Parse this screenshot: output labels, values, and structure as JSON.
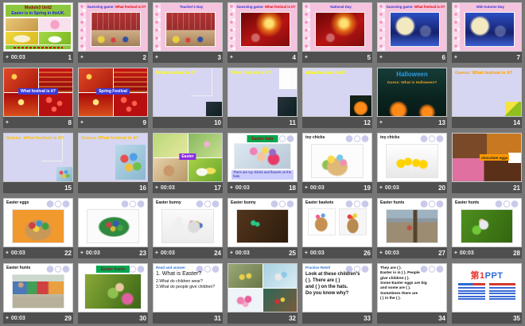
{
  "app": {
    "view": "slide-sorter-grid",
    "background": "#767676",
    "bar_bg": "#4f4f4f",
    "number_color": "#f5f5f5",
    "time_color": "#ededed",
    "star_color": "#d6d6d6",
    "transition_icon": "✦"
  },
  "slides": [
    {
      "n": "1",
      "time": "00:03",
      "star": true,
      "kind": "cover",
      "header_bg": "#8dc63f",
      "header": [
        {
          "t": "Module3 Unit2",
          "c": "#8b0000"
        },
        {
          "t": "Easter is in Spring in theUK.",
          "c": "#1a1aff"
        }
      ],
      "imgs": [
        "ph-c1",
        "ph-c2",
        "ph-c3",
        "ph-c4"
      ]
    },
    {
      "n": "2",
      "star": true,
      "kind": "pink",
      "photo": "ph-school",
      "title": [
        {
          "t": "Guessing game:",
          "c": "#3333cc"
        },
        {
          "t": "What festival is it?",
          "c": "#e60000"
        }
      ]
    },
    {
      "n": "3",
      "star": true,
      "kind": "pink",
      "photo": "ph-school",
      "title": [
        {
          "t": "Teacher's Day",
          "c": "#3333cc"
        }
      ]
    },
    {
      "n": "4",
      "star": true,
      "kind": "pink",
      "photo": "ph-national",
      "title": [
        {
          "t": "Guessing game:",
          "c": "#3333cc"
        },
        {
          "t": "What festival is it?",
          "c": "#e60000"
        }
      ]
    },
    {
      "n": "5",
      "star": true,
      "kind": "pink",
      "photo": "ph-national",
      "title": [
        {
          "t": "National Day",
          "c": "#3333cc"
        }
      ]
    },
    {
      "n": "6",
      "star": true,
      "kind": "pink",
      "photo": "ph-moon",
      "title": [
        {
          "t": "Guessing game:",
          "c": "#3333cc"
        },
        {
          "t": "What festival is it?",
          "c": "#e60000"
        }
      ]
    },
    {
      "n": "7",
      "star": true,
      "kind": "pink",
      "photo": "ph-moon",
      "title": [
        {
          "t": "Mid-Autumn Day",
          "c": "#3333cc"
        }
      ]
    },
    {
      "n": "8",
      "star": true,
      "kind": "gridlabel",
      "imgs": [
        "ph-r1",
        "ph-r2",
        "ph-r3",
        "ph-r4"
      ],
      "label": {
        "t": "What festival is it?",
        "bg": "#3b3bd8",
        "c": "#ffffff"
      }
    },
    {
      "n": "9",
      "star": true,
      "kind": "gridlabel",
      "imgs": [
        "ph-r1",
        "ph-r2",
        "ph-r3",
        "ph-r4"
      ],
      "label": {
        "t": "Spring Festival",
        "bg": "#3b3bd8",
        "c": "#ffffff"
      }
    },
    {
      "n": "10",
      "star": false,
      "kind": "quest",
      "text": "What festival is it?",
      "c": "#ffff00",
      "img": "ph-corner-dark",
      "img_size": "xs",
      "box": "outline"
    },
    {
      "n": "11",
      "star": false,
      "kind": "quest",
      "text": "What festival is it?",
      "c": "#ffff00",
      "img": "ph-corner-dark",
      "img_size": "sm",
      "box": "white"
    },
    {
      "n": "12",
      "star": false,
      "kind": "quest",
      "text": "What festival is it?",
      "c": "#ffff00",
      "img": "ph-pumpkin",
      "img_size": "md"
    },
    {
      "n": "13",
      "star": true,
      "kind": "hallow",
      "title": "Halloween",
      "title_c": "#2e9be6",
      "sub": "Guess: What is Halloween?",
      "sub_c": "#e8a020"
    },
    {
      "n": "14",
      "star": false,
      "kind": "quest",
      "text": "Guess: What festival is it?",
      "c": "#ffa000",
      "img": "ph-fold",
      "img_size": "xs"
    },
    {
      "n": "15",
      "star": false,
      "kind": "quest",
      "text": "Guess: What festival is it?",
      "c": "#ffc000",
      "img": "ph-eggs-mini",
      "img_size": "xs",
      "box": "outline"
    },
    {
      "n": "16",
      "star": false,
      "kind": "quest",
      "text": "Guess: What festival is it?",
      "c": "#ffc000",
      "img": "ph-eggs-mini",
      "img_size": "tall"
    },
    {
      "n": "17",
      "time": "00:03",
      "star": true,
      "kind": "gridlabel",
      "imgs": [
        "ph-q1",
        "ph-q2",
        "ph-q3",
        "ph-q4"
      ],
      "label": {
        "t": "Easter",
        "bg": "#8a2be2",
        "c": "#ffffff"
      }
    },
    {
      "n": "18",
      "time": "00:03",
      "star": true,
      "kind": "banner",
      "photo": "ph-child-hat",
      "banner": {
        "t": "Easter hats",
        "bg": "#00a650",
        "c": "#c00000"
      },
      "caption": {
        "t": "There are toy chicks and flowers on the hats.",
        "bg": "#ccccff",
        "c": "#1a1a8c"
      }
    },
    {
      "n": "19",
      "time": "00:03",
      "star": true,
      "kind": "white",
      "label": "toy chicks",
      "img": "ph-basket-chicks"
    },
    {
      "n": "20",
      "time": "00:03",
      "star": true,
      "kind": "white",
      "label": "toy chicks",
      "img": "ph-toy-chicks"
    },
    {
      "n": "21",
      "star": false,
      "kind": "collage",
      "label": {
        "t": "chocolate eggs",
        "bg": "#ff9900",
        "c": "#222222"
      }
    },
    {
      "n": "22",
      "time": "00:03",
      "star": true,
      "kind": "white",
      "label": "Easter eggs",
      "img": "ph-eggs-orange"
    },
    {
      "n": "23",
      "time": "00:03",
      "star": true,
      "kind": "white",
      "label": null,
      "img": "ph-eggs-plate"
    },
    {
      "n": "24",
      "time": "00:03",
      "star": true,
      "kind": "white",
      "label": "Easter bunny",
      "img": "ph-rabbit"
    },
    {
      "n": "25",
      "time": "00:03",
      "star": true,
      "kind": "white",
      "label": "Easter bunny",
      "img": "ph-neon"
    },
    {
      "n": "26",
      "time": "00:03",
      "star": true,
      "kind": "two",
      "label": "Easter baskets",
      "imgs": [
        "ph-basket-cartoon",
        "ph-basket-tulips"
      ]
    },
    {
      "n": "27",
      "time": "00:03",
      "star": true,
      "kind": "white",
      "label": "Easter hunts",
      "img": "ph-hunt-outdoor"
    },
    {
      "n": "28",
      "time": "00:03",
      "star": true,
      "kind": "white",
      "label": "Easter hunts",
      "img": "ph-hunt-grass"
    },
    {
      "n": "29",
      "time": "00:03",
      "star": true,
      "kind": "white",
      "label": "Easter hunts",
      "img": "ph-hunt-kids"
    },
    {
      "n": "30",
      "star": false,
      "kind": "banner",
      "photo": "ph-hunt-girl",
      "banner": {
        "t": "Easter hunts",
        "bg": "#00a650",
        "c": "#7b2020"
      }
    },
    {
      "n": "31",
      "star": false,
      "kind": "qa",
      "label": {
        "t": "Read and answer",
        "c": "#2e75d4"
      },
      "big_first": true,
      "lines": [
        "1. What is Easter?",
        "2.What do children wear?",
        "3.What do people give children?"
      ]
    },
    {
      "n": "32",
      "star": false,
      "kind": "grid4",
      "imgs": [
        "ph-g1",
        "ph-g2",
        "ph-g3",
        "ph-g4"
      ]
    },
    {
      "n": "33",
      "star": false,
      "kind": "qa",
      "label": {
        "t": "Practice Retell",
        "c": "#2e75d4"
      },
      "bold": true,
      "lines": [
        "Look at these children's",
        "(  ). There are (    )",
        "and (  ) on the hats.",
        "Do you know why?"
      ]
    },
    {
      "n": "34",
      "star": false,
      "kind": "qa",
      "label": null,
      "small": true,
      "lines": [
        "They are (   ).",
        "Easter is in (  ). People",
        "give children (    ).",
        "Some Easter eggs are big",
        "and some are (  ).",
        "Sometimes there are",
        "(     ) in the (   )."
      ]
    },
    {
      "n": "35",
      "star": false,
      "kind": "logo",
      "brand": [
        {
          "t": "第1",
          "c": "#e8382d"
        },
        {
          "t": "PPT",
          "c": "#2b6bd4"
        }
      ]
    }
  ]
}
